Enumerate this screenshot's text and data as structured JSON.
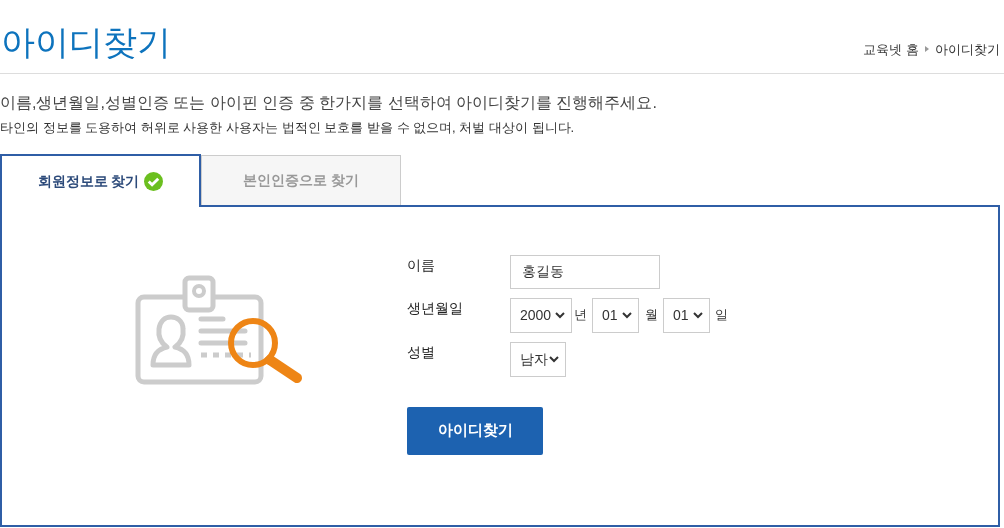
{
  "page_title": "아이디찾기",
  "breadcrumb": [
    {
      "label": "교육넷 홈"
    },
    {
      "label": "아이디찾기"
    }
  ],
  "intro": "이름,생년월일,성별인증 또는 아이핀 인증 중 한가지를 선택하여 아이디찾기를 진행해주세요.",
  "notice": "타인의 정보를 도용하여 허위로 사용한 사용자는 법적인 보호를 받을 수 없으며, 처벌 대상이 됩니다.",
  "tabs": [
    {
      "label": "회원정보로 찾기",
      "selected": true
    },
    {
      "label": "본인인증으로 찾기",
      "selected": false
    }
  ],
  "form": {
    "name": {
      "label": "이름",
      "value": "홍길동"
    },
    "birth": {
      "label": "생년월일",
      "year": "2000",
      "year_unit": "년",
      "month": "01",
      "month_unit": "월",
      "day": "01",
      "day_unit": "일"
    },
    "gender": {
      "label": "성별",
      "value": "남자"
    },
    "submit": "아이디찾기"
  }
}
